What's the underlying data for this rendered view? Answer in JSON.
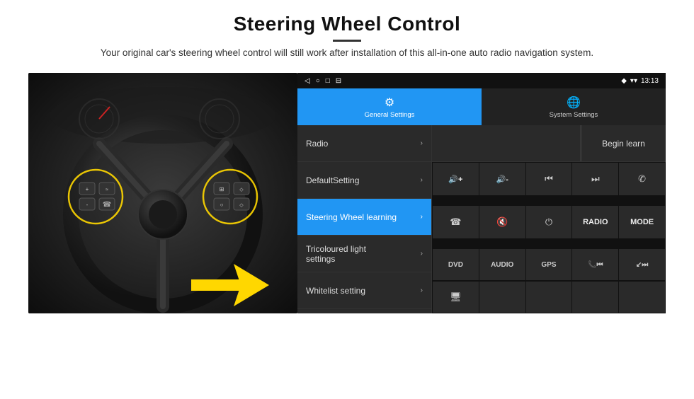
{
  "header": {
    "title": "Steering Wheel Control",
    "subtitle": "Your original car's steering wheel control will still work after installation of this all-in-one auto radio navigation system."
  },
  "status_bar": {
    "nav_back": "◁",
    "nav_home": "○",
    "nav_square": "□",
    "nav_menu": "⊟",
    "location_icon": "◆",
    "wifi_icon": "▾",
    "time": "13:13"
  },
  "tabs": [
    {
      "label": "General Settings",
      "icon": "⚙",
      "active": true
    },
    {
      "label": "System Settings",
      "icon": "🌐",
      "active": false
    }
  ],
  "menu_items": [
    {
      "label": "Radio",
      "active": false
    },
    {
      "label": "DefaultSetting",
      "active": false
    },
    {
      "label": "Steering Wheel learning",
      "active": true
    },
    {
      "label": "Tricoloured light settings",
      "active": false
    },
    {
      "label": "Whitelist setting",
      "active": false
    }
  ],
  "begin_learn_label": "Begin learn",
  "controls": [
    {
      "symbol": "🔊+",
      "type": "text"
    },
    {
      "symbol": "🔊-",
      "type": "text"
    },
    {
      "symbol": "⏮",
      "type": "icon"
    },
    {
      "symbol": "⏭",
      "type": "icon"
    },
    {
      "symbol": "✆",
      "type": "icon"
    },
    {
      "symbol": "☎",
      "type": "icon"
    },
    {
      "symbol": "🔇",
      "type": "icon"
    },
    {
      "symbol": "⏻",
      "type": "icon"
    },
    {
      "symbol": "RADIO",
      "type": "text"
    },
    {
      "symbol": "MODE",
      "type": "text"
    }
  ],
  "bottom_buttons": [
    "DVD",
    "AUDIO",
    "GPS",
    "📞⏮",
    "↙⏭"
  ],
  "extra_buttons": [
    "🖥"
  ]
}
